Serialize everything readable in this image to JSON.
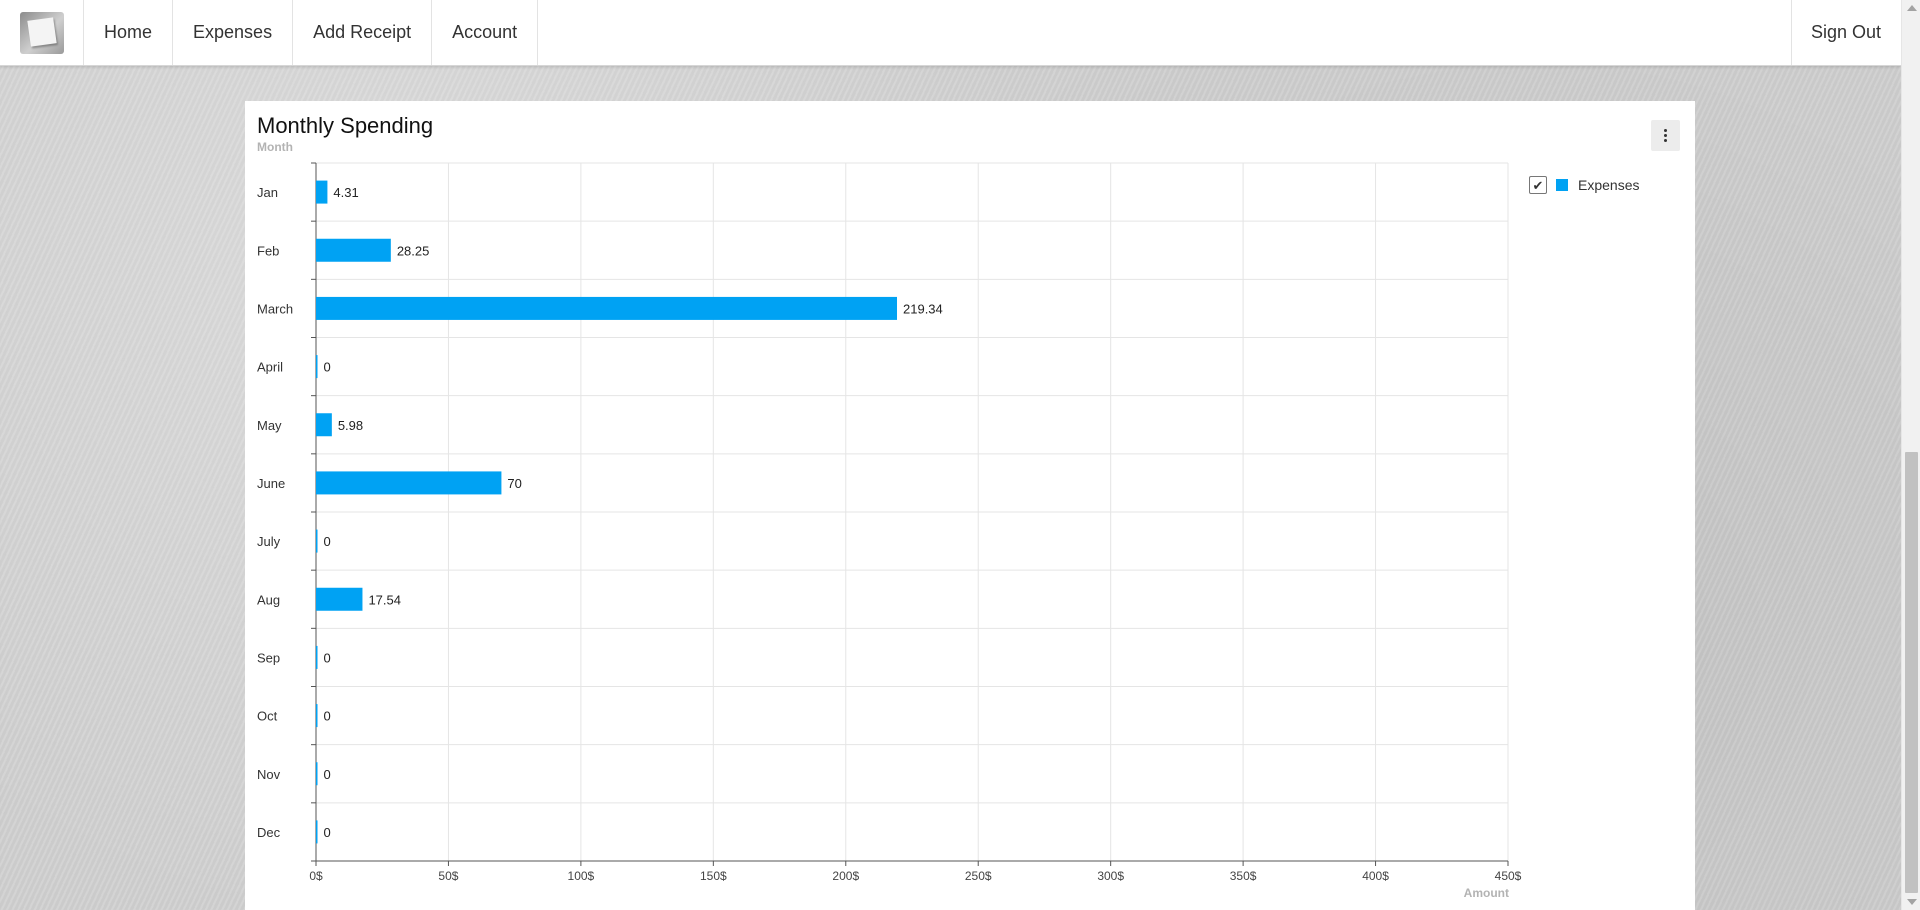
{
  "nav": {
    "items": [
      "Home",
      "Expenses",
      "Add Receipt",
      "Account"
    ],
    "sign_out": "Sign Out"
  },
  "card": {
    "menu_icon": "more-vertical-icon"
  },
  "legend": {
    "check_glyph": "✔",
    "label": "Expenses"
  },
  "colors": {
    "bar": "#00a2f3",
    "grid": "#e5e5e5",
    "axis": "#555555"
  },
  "chart_data": {
    "type": "bar",
    "orientation": "horizontal",
    "title": "Monthly Spending",
    "ylabel": "Month",
    "xlabel": "Amount",
    "categories": [
      "Jan",
      "Feb",
      "March",
      "April",
      "May",
      "June",
      "July",
      "Aug",
      "Sep",
      "Oct",
      "Nov",
      "Dec"
    ],
    "values": [
      4.31,
      28.25,
      219.34,
      0,
      5.98,
      70,
      0,
      17.54,
      0,
      0,
      0,
      0
    ],
    "value_labels": [
      "4.31",
      "28.25",
      "219.34",
      "0",
      "5.98",
      "70",
      "0",
      "17.54",
      "0",
      "0",
      "0",
      "0"
    ],
    "xlim": [
      0,
      450
    ],
    "xticks": [
      0,
      50,
      100,
      150,
      200,
      250,
      300,
      350,
      400,
      450
    ],
    "xtick_labels": [
      "0$",
      "50$",
      "100$",
      "150$",
      "200$",
      "250$",
      "300$",
      "350$",
      "400$",
      "450$"
    ],
    "grid": true,
    "legend": "top-right",
    "series": [
      {
        "name": "Expenses",
        "values": [
          4.31,
          28.25,
          219.34,
          0,
          5.98,
          70,
          0,
          17.54,
          0,
          0,
          0,
          0
        ]
      }
    ]
  }
}
